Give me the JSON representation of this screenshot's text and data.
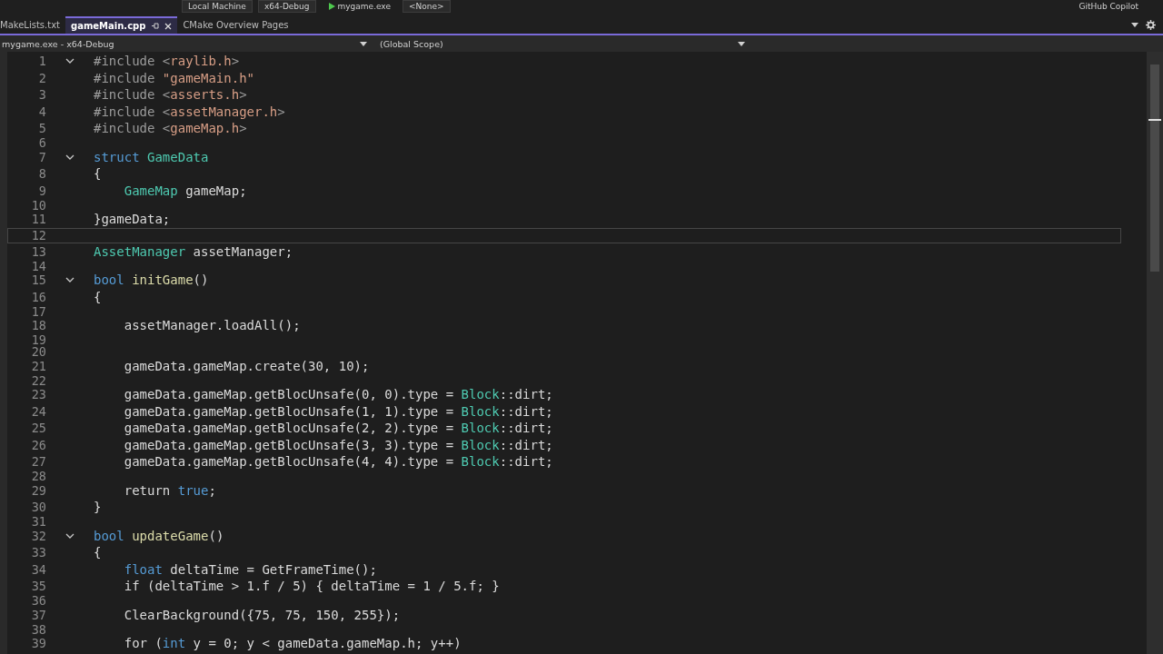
{
  "toolbar": {
    "items": [
      {
        "kind": "dropdown",
        "label": "Local Machine"
      },
      {
        "kind": "dropdown",
        "label": "x64-Debug"
      },
      {
        "kind": "run",
        "label": "mygame.exe"
      },
      {
        "kind": "dropdown",
        "label": "<None>"
      },
      {
        "kind": "copilot",
        "label": "GitHub Copilot"
      }
    ]
  },
  "tabs": [
    {
      "label": "MakeLists.txt",
      "selected": false
    },
    {
      "label": "gameMain.cpp",
      "selected": true
    },
    {
      "label": "CMake Overview Pages",
      "selected": false
    }
  ],
  "navigation_bar": {
    "project": "mygame.exe - x64-Debug",
    "scope": "(Global Scope)"
  },
  "editor": {
    "lines": [
      {
        "number": "1",
        "current": false,
        "fold": {
          "expanded": true
        },
        "tokens": [
          {
            "text": "#include ",
            "kind": "preproc"
          },
          {
            "text": "<",
            "kind": "preproc"
          },
          {
            "text": "raylib.h",
            "kind": "string"
          },
          {
            "text": ">",
            "kind": "preproc"
          }
        ]
      },
      {
        "number": "2",
        "current": false,
        "tokens": [
          {
            "text": "#include ",
            "kind": "preproc"
          },
          {
            "text": "\"gameMain.h\"",
            "kind": "string"
          }
        ]
      },
      {
        "number": "3",
        "current": false,
        "tokens": [
          {
            "text": "#include ",
            "kind": "preproc"
          },
          {
            "text": "<",
            "kind": "preproc"
          },
          {
            "text": "asserts.h",
            "kind": "string"
          },
          {
            "text": ">",
            "kind": "preproc"
          }
        ]
      },
      {
        "number": "4",
        "current": false,
        "tokens": [
          {
            "text": "#include ",
            "kind": "preproc"
          },
          {
            "text": "<",
            "kind": "preproc"
          },
          {
            "text": "assetManager.h",
            "kind": "string"
          },
          {
            "text": ">",
            "kind": "preproc"
          }
        ]
      },
      {
        "number": "5",
        "current": false,
        "tokens": [
          {
            "text": "#include ",
            "kind": "preproc"
          },
          {
            "text": "<",
            "kind": "preproc"
          },
          {
            "text": "gameMap.h",
            "kind": "string"
          },
          {
            "text": ">",
            "kind": "preproc"
          }
        ]
      },
      {
        "number": "6",
        "current": false
      },
      {
        "number": "7",
        "current": false,
        "fold": {
          "expanded": true
        },
        "tokens": [
          {
            "text": "struct ",
            "kind": "keyword"
          },
          {
            "text": "GameData",
            "kind": "type"
          }
        ]
      },
      {
        "number": "8",
        "current": false,
        "tokens": [
          {
            "text": "{",
            "kind": "plain"
          }
        ]
      },
      {
        "number": "9",
        "current": false,
        "tokens": [
          {
            "text": "    GameMap",
            "kind": "type"
          },
          {
            "text": " gameMap;",
            "kind": "plain"
          }
        ]
      },
      {
        "number": "10",
        "current": false
      },
      {
        "number": "11",
        "current": false,
        "tokens": [
          {
            "text": "}gameData;",
            "kind": "plain"
          }
        ]
      },
      {
        "number": "12",
        "current": true
      },
      {
        "number": "13",
        "current": false,
        "tokens": [
          {
            "text": "AssetManager",
            "kind": "type"
          },
          {
            "text": " assetManager;",
            "kind": "plain"
          }
        ]
      },
      {
        "number": "14",
        "current": false
      },
      {
        "number": "15",
        "current": false,
        "fold": {
          "expanded": true
        },
        "tokens": [
          {
            "text": "bool ",
            "kind": "keyword"
          },
          {
            "text": "initGame",
            "kind": "function"
          },
          {
            "text": "()",
            "kind": "plain"
          }
        ]
      },
      {
        "number": "16",
        "current": false,
        "tokens": [
          {
            "text": "{",
            "kind": "plain"
          }
        ]
      },
      {
        "number": "17",
        "current": false
      },
      {
        "number": "18",
        "current": false,
        "tokens": [
          {
            "text": "    assetManager.loadAll();",
            "kind": "plain"
          }
        ]
      },
      {
        "number": "19",
        "current": false
      },
      {
        "number": "20",
        "current": false
      },
      {
        "number": "21",
        "current": false,
        "tokens": [
          {
            "text": "    gameData.gameMap.create(30, 10);",
            "kind": "plain"
          }
        ]
      },
      {
        "number": "22",
        "current": false
      },
      {
        "number": "23",
        "current": false,
        "tokens": [
          {
            "text": "    gameData.gameMap.getBlocUnsafe(0, 0).type = ",
            "kind": "plain"
          },
          {
            "text": "Block",
            "kind": "type"
          },
          {
            "text": "::dirt;",
            "kind": "plain"
          }
        ]
      },
      {
        "number": "24",
        "current": false,
        "tokens": [
          {
            "text": "    gameData.gameMap.getBlocUnsafe(1, 1).type = ",
            "kind": "plain"
          },
          {
            "text": "Block",
            "kind": "type"
          },
          {
            "text": "::dirt;",
            "kind": "plain"
          }
        ]
      },
      {
        "number": "25",
        "current": false,
        "tokens": [
          {
            "text": "    gameData.gameMap.getBlocUnsafe(2, 2).type = ",
            "kind": "plain"
          },
          {
            "text": "Block",
            "kind": "type"
          },
          {
            "text": "::dirt;",
            "kind": "plain"
          }
        ]
      },
      {
        "number": "26",
        "current": false,
        "tokens": [
          {
            "text": "    gameData.gameMap.getBlocUnsafe(3, 3).type = ",
            "kind": "plain"
          },
          {
            "text": "Block",
            "kind": "type"
          },
          {
            "text": "::dirt;",
            "kind": "plain"
          }
        ]
      },
      {
        "number": "27",
        "current": false,
        "tokens": [
          {
            "text": "    gameData.gameMap.getBlocUnsafe(4, 4).type = ",
            "kind": "plain"
          },
          {
            "text": "Block",
            "kind": "type"
          },
          {
            "text": "::dirt;",
            "kind": "plain"
          }
        ]
      },
      {
        "number": "28",
        "current": false
      },
      {
        "number": "29",
        "current": false,
        "tokens": [
          {
            "text": "    return ",
            "kind": "plain"
          },
          {
            "text": "true",
            "kind": "keyword"
          },
          {
            "text": ";",
            "kind": "plain"
          }
        ]
      },
      {
        "number": "30",
        "current": false,
        "tokens": [
          {
            "text": "}",
            "kind": "plain"
          }
        ]
      },
      {
        "number": "31",
        "current": false
      },
      {
        "number": "32",
        "current": false,
        "fold": {
          "expanded": true
        },
        "tokens": [
          {
            "text": "bool ",
            "kind": "keyword"
          },
          {
            "text": "updateGame",
            "kind": "function"
          },
          {
            "text": "()",
            "kind": "plain"
          }
        ]
      },
      {
        "number": "33",
        "current": false,
        "tokens": [
          {
            "text": "{",
            "kind": "plain"
          }
        ]
      },
      {
        "number": "34",
        "current": false,
        "tokens": [
          {
            "text": "    float ",
            "kind": "keyword"
          },
          {
            "text": "deltaTime = GetFrameTime();",
            "kind": "plain"
          }
        ]
      },
      {
        "number": "35",
        "current": false,
        "tokens": [
          {
            "text": "    if (deltaTime > 1.f / 5) { deltaTime = 1 / 5.f; }",
            "kind": "plain"
          }
        ]
      },
      {
        "number": "36",
        "current": false
      },
      {
        "number": "37",
        "current": false,
        "tokens": [
          {
            "text": "    ClearBackground({75, 75, 150, 255});",
            "kind": "plain"
          }
        ]
      },
      {
        "number": "38",
        "current": false
      },
      {
        "number": "39",
        "current": false,
        "tokens": [
          {
            "text": "    for (",
            "kind": "plain"
          },
          {
            "text": "int ",
            "kind": "keyword"
          },
          {
            "text": "y = 0; y < gameData.gameMap.h; y++)",
            "kind": "plain"
          }
        ]
      }
    ]
  }
}
